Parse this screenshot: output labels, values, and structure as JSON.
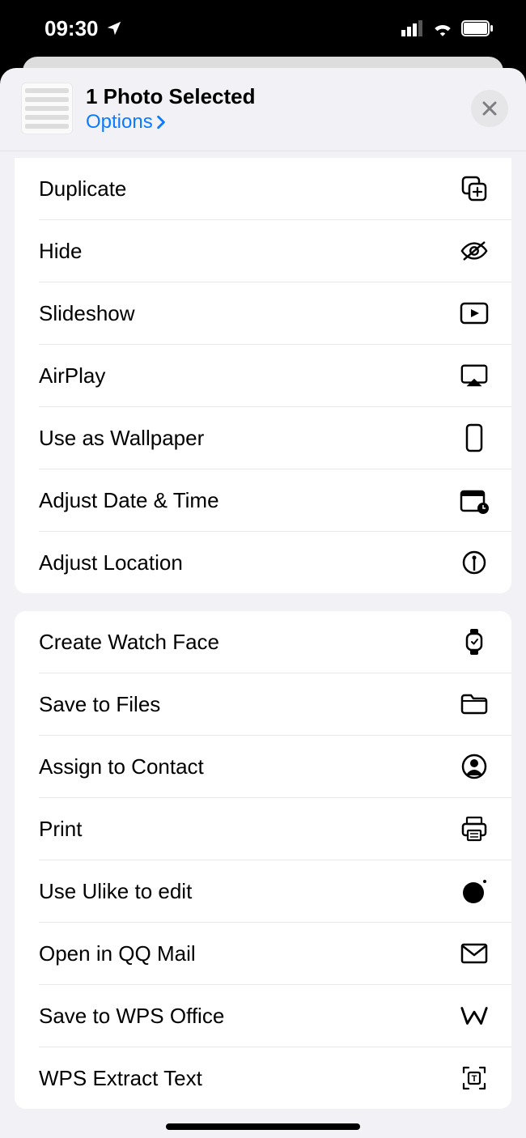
{
  "status": {
    "time": "09:30"
  },
  "header": {
    "title": "1 Photo Selected",
    "subtitle": "Options"
  },
  "group1": [
    {
      "label": "Duplicate",
      "icon": "duplicate"
    },
    {
      "label": "Hide",
      "icon": "hide"
    },
    {
      "label": "Slideshow",
      "icon": "slideshow"
    },
    {
      "label": "AirPlay",
      "icon": "airplay"
    },
    {
      "label": "Use as Wallpaper",
      "icon": "wallpaper"
    },
    {
      "label": "Adjust Date & Time",
      "icon": "datetime"
    },
    {
      "label": "Adjust Location",
      "icon": "location"
    }
  ],
  "group2": [
    {
      "label": "Create Watch Face",
      "icon": "watch"
    },
    {
      "label": "Save to Files",
      "icon": "files"
    },
    {
      "label": "Assign to Contact",
      "icon": "contact"
    },
    {
      "label": "Print",
      "icon": "print"
    },
    {
      "label": "Use Ulike to edit",
      "icon": "ulike"
    },
    {
      "label": "Open in QQ Mail",
      "icon": "mail"
    },
    {
      "label": "Save to WPS Office",
      "icon": "wps"
    },
    {
      "label": "WPS Extract Text",
      "icon": "extract"
    }
  ]
}
